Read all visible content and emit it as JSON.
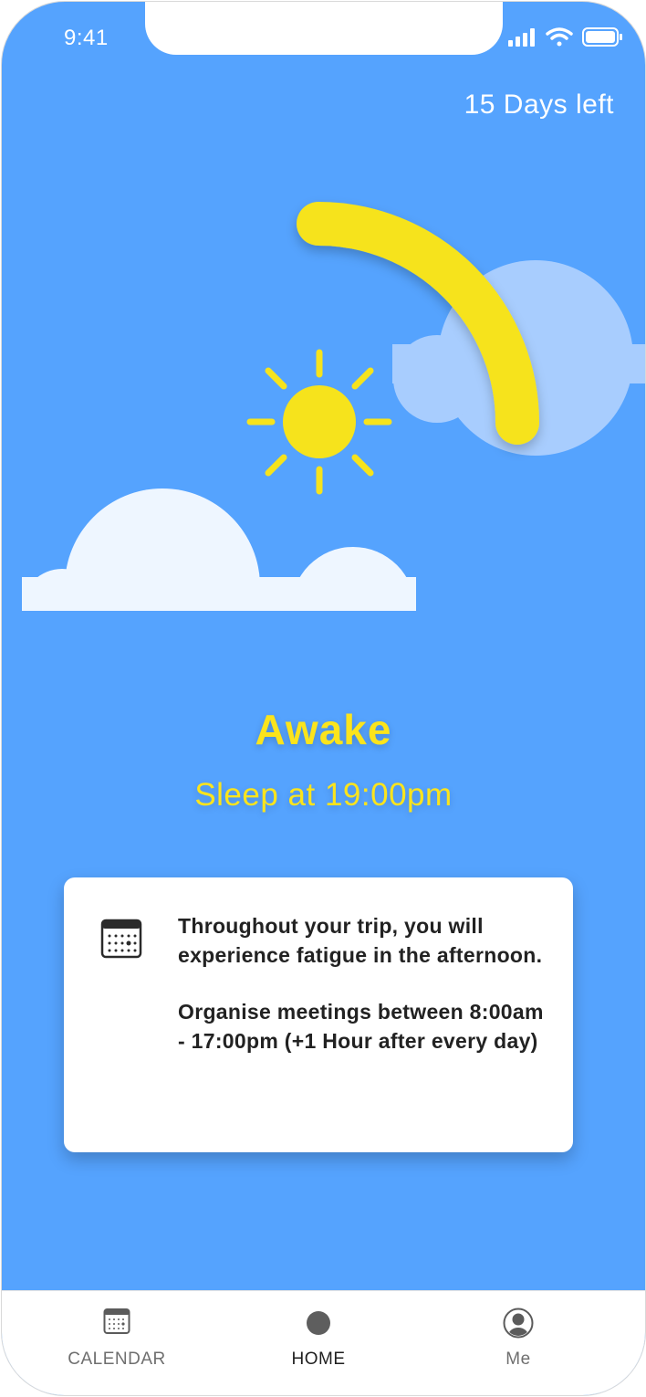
{
  "status_bar": {
    "time": "9:41"
  },
  "header": {
    "days_left": "15 Days left"
  },
  "hero": {
    "title": "Awake",
    "subtitle": "Sleep at 19:00pm"
  },
  "card": {
    "icon": "calendar-icon",
    "paragraph_1": "Throughout your trip, you will experience fatigue in the afternoon.",
    "paragraph_2": "Organise meetings between 8:00am - 17:00pm (+1 Hour after every day)"
  },
  "tabbar": {
    "items": [
      {
        "label": "CALENDAR",
        "icon": "calendar-icon"
      },
      {
        "label": "HOME",
        "icon": "home-dot-icon",
        "active": true
      },
      {
        "label": "Me",
        "icon": "profile-icon"
      }
    ]
  },
  "colors": {
    "background": "#55a3fe",
    "accent_yellow": "#fbe41c",
    "cloud_front": "#eef6ff",
    "cloud_back": "#a8cdfe"
  }
}
